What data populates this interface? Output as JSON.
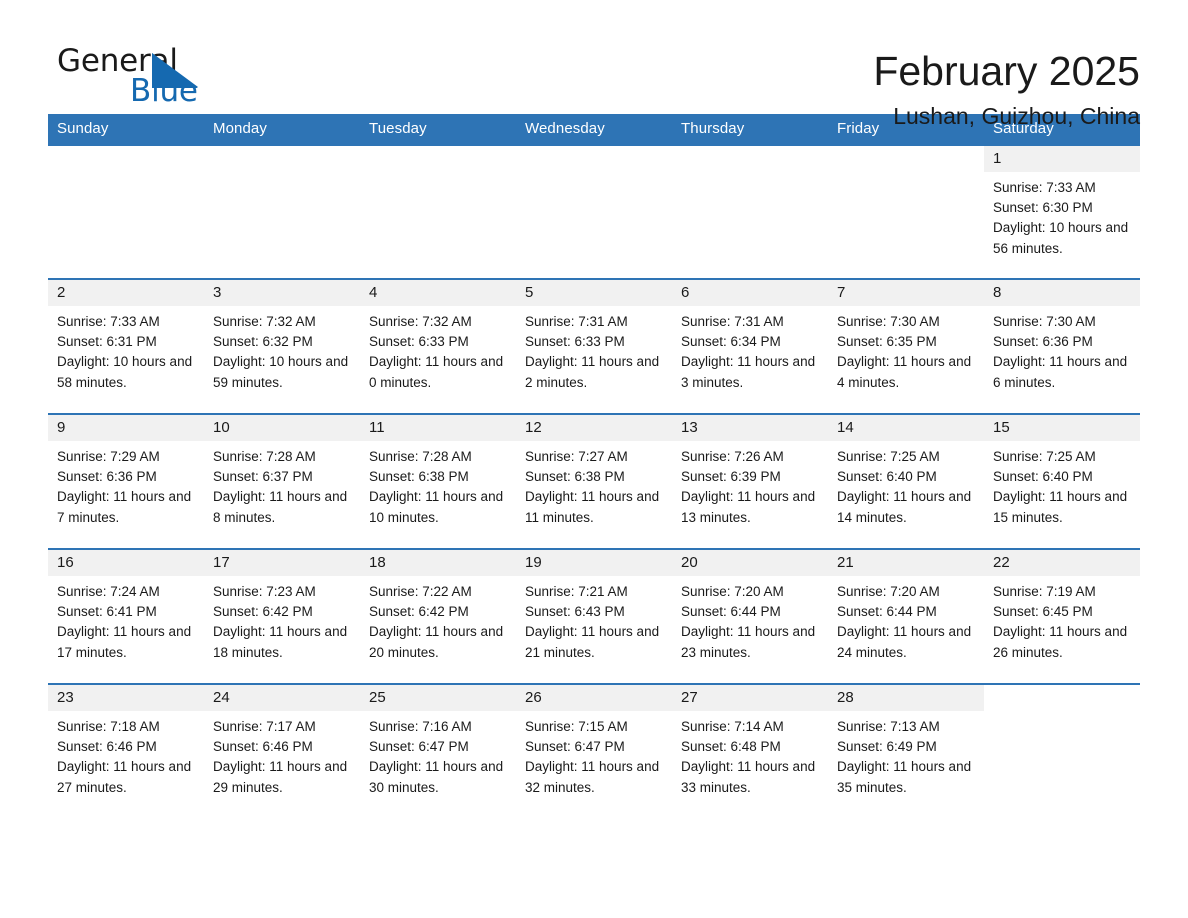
{
  "brand": {
    "name_part1": "General",
    "name_part2": "Blue",
    "logo_icon": "blue-triangle-icon",
    "accent_color": "#1569b0"
  },
  "header": {
    "month_title": "February 2025",
    "location": "Lushan, Guizhou, China"
  },
  "theme": {
    "header_blue": "#2e74b5",
    "daynum_band_gray": "#f1f1f1",
    "text_color": "#1a1a1a"
  },
  "calendar": {
    "weekday_headers": [
      "Sunday",
      "Monday",
      "Tuesday",
      "Wednesday",
      "Thursday",
      "Friday",
      "Saturday"
    ],
    "weeks": [
      [
        {
          "day": "",
          "sunrise": "",
          "sunset": "",
          "daylight": ""
        },
        {
          "day": "",
          "sunrise": "",
          "sunset": "",
          "daylight": ""
        },
        {
          "day": "",
          "sunrise": "",
          "sunset": "",
          "daylight": ""
        },
        {
          "day": "",
          "sunrise": "",
          "sunset": "",
          "daylight": ""
        },
        {
          "day": "",
          "sunrise": "",
          "sunset": "",
          "daylight": ""
        },
        {
          "day": "",
          "sunrise": "",
          "sunset": "",
          "daylight": ""
        },
        {
          "day": "1",
          "sunrise": "Sunrise: 7:33 AM",
          "sunset": "Sunset: 6:30 PM",
          "daylight": "Daylight: 10 hours and 56 minutes."
        }
      ],
      [
        {
          "day": "2",
          "sunrise": "Sunrise: 7:33 AM",
          "sunset": "Sunset: 6:31 PM",
          "daylight": "Daylight: 10 hours and 58 minutes."
        },
        {
          "day": "3",
          "sunrise": "Sunrise: 7:32 AM",
          "sunset": "Sunset: 6:32 PM",
          "daylight": "Daylight: 10 hours and 59 minutes."
        },
        {
          "day": "4",
          "sunrise": "Sunrise: 7:32 AM",
          "sunset": "Sunset: 6:33 PM",
          "daylight": "Daylight: 11 hours and 0 minutes."
        },
        {
          "day": "5",
          "sunrise": "Sunrise: 7:31 AM",
          "sunset": "Sunset: 6:33 PM",
          "daylight": "Daylight: 11 hours and 2 minutes."
        },
        {
          "day": "6",
          "sunrise": "Sunrise: 7:31 AM",
          "sunset": "Sunset: 6:34 PM",
          "daylight": "Daylight: 11 hours and 3 minutes."
        },
        {
          "day": "7",
          "sunrise": "Sunrise: 7:30 AM",
          "sunset": "Sunset: 6:35 PM",
          "daylight": "Daylight: 11 hours and 4 minutes."
        },
        {
          "day": "8",
          "sunrise": "Sunrise: 7:30 AM",
          "sunset": "Sunset: 6:36 PM",
          "daylight": "Daylight: 11 hours and 6 minutes."
        }
      ],
      [
        {
          "day": "9",
          "sunrise": "Sunrise: 7:29 AM",
          "sunset": "Sunset: 6:36 PM",
          "daylight": "Daylight: 11 hours and 7 minutes."
        },
        {
          "day": "10",
          "sunrise": "Sunrise: 7:28 AM",
          "sunset": "Sunset: 6:37 PM",
          "daylight": "Daylight: 11 hours and 8 minutes."
        },
        {
          "day": "11",
          "sunrise": "Sunrise: 7:28 AM",
          "sunset": "Sunset: 6:38 PM",
          "daylight": "Daylight: 11 hours and 10 minutes."
        },
        {
          "day": "12",
          "sunrise": "Sunrise: 7:27 AM",
          "sunset": "Sunset: 6:38 PM",
          "daylight": "Daylight: 11 hours and 11 minutes."
        },
        {
          "day": "13",
          "sunrise": "Sunrise: 7:26 AM",
          "sunset": "Sunset: 6:39 PM",
          "daylight": "Daylight: 11 hours and 13 minutes."
        },
        {
          "day": "14",
          "sunrise": "Sunrise: 7:25 AM",
          "sunset": "Sunset: 6:40 PM",
          "daylight": "Daylight: 11 hours and 14 minutes."
        },
        {
          "day": "15",
          "sunrise": "Sunrise: 7:25 AM",
          "sunset": "Sunset: 6:40 PM",
          "daylight": "Daylight: 11 hours and 15 minutes."
        }
      ],
      [
        {
          "day": "16",
          "sunrise": "Sunrise: 7:24 AM",
          "sunset": "Sunset: 6:41 PM",
          "daylight": "Daylight: 11 hours and 17 minutes."
        },
        {
          "day": "17",
          "sunrise": "Sunrise: 7:23 AM",
          "sunset": "Sunset: 6:42 PM",
          "daylight": "Daylight: 11 hours and 18 minutes."
        },
        {
          "day": "18",
          "sunrise": "Sunrise: 7:22 AM",
          "sunset": "Sunset: 6:42 PM",
          "daylight": "Daylight: 11 hours and 20 minutes."
        },
        {
          "day": "19",
          "sunrise": "Sunrise: 7:21 AM",
          "sunset": "Sunset: 6:43 PM",
          "daylight": "Daylight: 11 hours and 21 minutes."
        },
        {
          "day": "20",
          "sunrise": "Sunrise: 7:20 AM",
          "sunset": "Sunset: 6:44 PM",
          "daylight": "Daylight: 11 hours and 23 minutes."
        },
        {
          "day": "21",
          "sunrise": "Sunrise: 7:20 AM",
          "sunset": "Sunset: 6:44 PM",
          "daylight": "Daylight: 11 hours and 24 minutes."
        },
        {
          "day": "22",
          "sunrise": "Sunrise: 7:19 AM",
          "sunset": "Sunset: 6:45 PM",
          "daylight": "Daylight: 11 hours and 26 minutes."
        }
      ],
      [
        {
          "day": "23",
          "sunrise": "Sunrise: 7:18 AM",
          "sunset": "Sunset: 6:46 PM",
          "daylight": "Daylight: 11 hours and 27 minutes."
        },
        {
          "day": "24",
          "sunrise": "Sunrise: 7:17 AM",
          "sunset": "Sunset: 6:46 PM",
          "daylight": "Daylight: 11 hours and 29 minutes."
        },
        {
          "day": "25",
          "sunrise": "Sunrise: 7:16 AM",
          "sunset": "Sunset: 6:47 PM",
          "daylight": "Daylight: 11 hours and 30 minutes."
        },
        {
          "day": "26",
          "sunrise": "Sunrise: 7:15 AM",
          "sunset": "Sunset: 6:47 PM",
          "daylight": "Daylight: 11 hours and 32 minutes."
        },
        {
          "day": "27",
          "sunrise": "Sunrise: 7:14 AM",
          "sunset": "Sunset: 6:48 PM",
          "daylight": "Daylight: 11 hours and 33 minutes."
        },
        {
          "day": "28",
          "sunrise": "Sunrise: 7:13 AM",
          "sunset": "Sunset: 6:49 PM",
          "daylight": "Daylight: 11 hours and 35 minutes."
        },
        {
          "day": "",
          "sunrise": "",
          "sunset": "",
          "daylight": ""
        }
      ]
    ]
  }
}
